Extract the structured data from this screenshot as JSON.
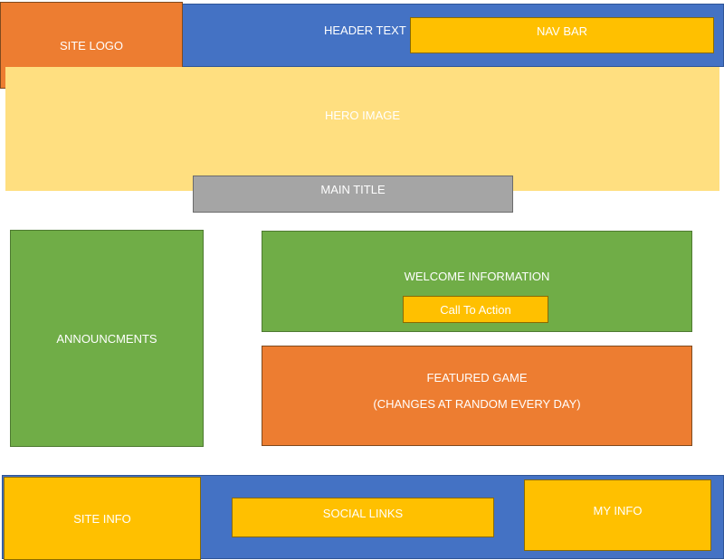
{
  "header": {
    "text": "HEADER TEXT",
    "logo": "SITE LOGO",
    "nav": "NAV BAR"
  },
  "hero": {
    "label": "HERO IMAGE",
    "main_title": "MAIN TITLE"
  },
  "content": {
    "announcements": "ANNOUNCMENTS",
    "welcome": "WELCOME INFORMATION",
    "cta": "Call To Action",
    "featured_title": "FEATURED GAME",
    "featured_note": "(CHANGES AT RANDOM EVERY DAY)"
  },
  "footer": {
    "site_info": "SITE INFO",
    "social_links": "SOCIAL LINKS",
    "my_info": "MY INFO"
  },
  "colors": {
    "blue": "#4472c4",
    "orange": "#ed7d31",
    "yellow": "#ffc000",
    "green": "#70ad47",
    "gray": "#a5a5a5",
    "hero": "#ffdf80"
  }
}
